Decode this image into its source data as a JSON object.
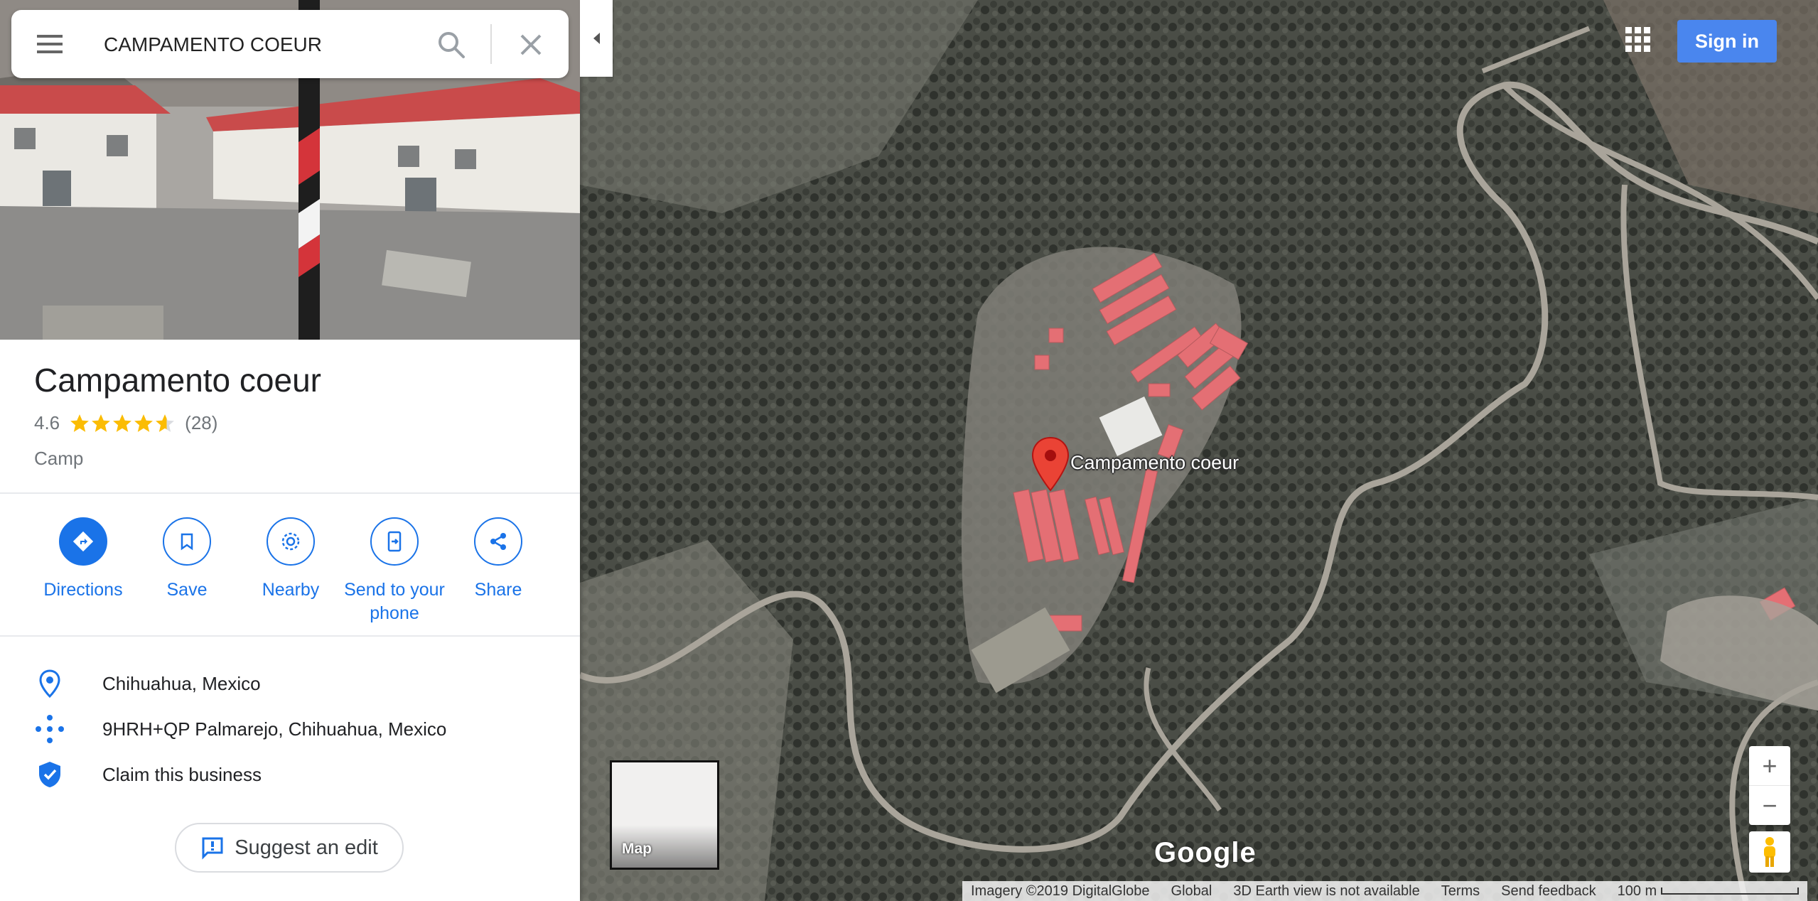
{
  "search": {
    "value": "CAMPAMENTO COEUR"
  },
  "place": {
    "title": "Campamento coeur",
    "rating": "4.6",
    "rating_value": 4.6,
    "reviews": "(28)",
    "category": "Camp"
  },
  "actions": [
    {
      "label": "Directions",
      "icon": "directions-icon"
    },
    {
      "label": "Save",
      "icon": "bookmark-icon"
    },
    {
      "label": "Nearby",
      "icon": "nearby-icon"
    },
    {
      "label": "Send to your phone",
      "icon": "send-to-phone-icon"
    },
    {
      "label": "Share",
      "icon": "share-icon"
    }
  ],
  "info": {
    "location": "Chihuahua, Mexico",
    "plus_code": "9HRH+QP Palmarejo, Chihuahua, Mexico",
    "claim": "Claim this business"
  },
  "suggest_edit": "Suggest an edit",
  "map": {
    "marker_label": "Campamento coeur",
    "sign_in": "Sign in",
    "minimap_label": "Map",
    "google_logo": "Google",
    "zoom_in": "+",
    "zoom_out": "−"
  },
  "footer": {
    "imagery": "Imagery ©2019 DigitalGlobe",
    "global": "Global",
    "earth": "3D Earth view is not available",
    "terms": "Terms",
    "feedback": "Send feedback",
    "scale": "100 m"
  },
  "colors": {
    "accent": "#1a73e8",
    "sign_in": "#4a86ee",
    "star": "#fbbc04",
    "marker": "#ea4335"
  }
}
